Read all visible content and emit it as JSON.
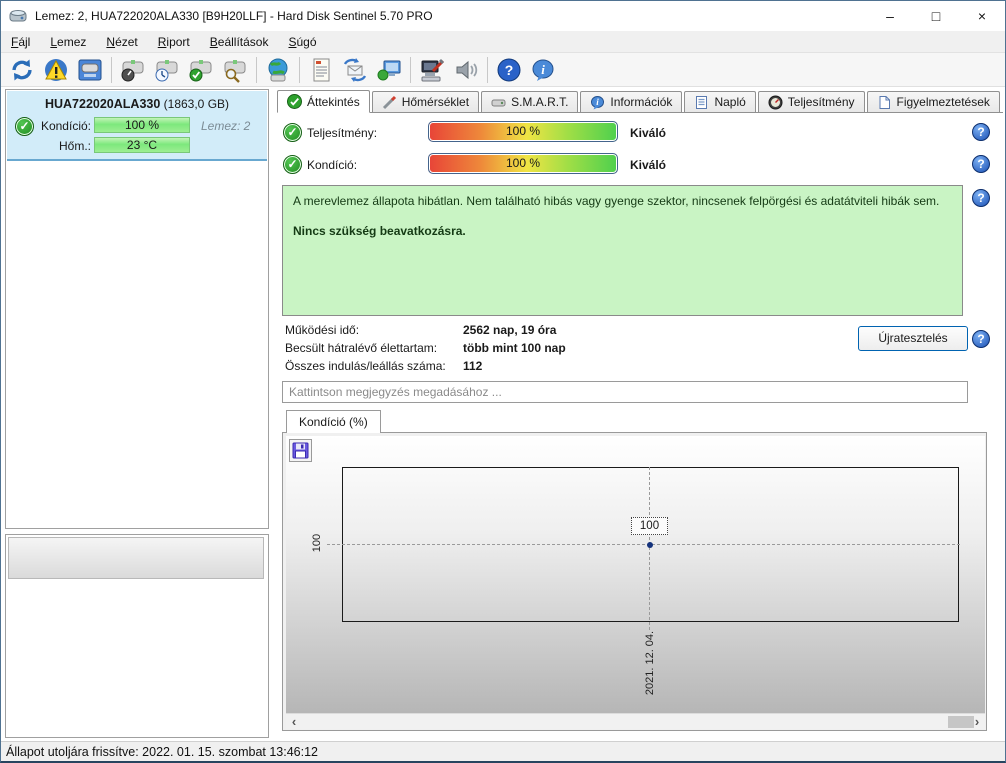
{
  "window": {
    "title": "Lemez: 2, HUA722020ALA330 [B9H20LLF]  -  Hard Disk Sentinel 5.70 PRO",
    "minimize": "–",
    "maximize": "□",
    "close": "×"
  },
  "menu": {
    "items": [
      {
        "accel": "F",
        "rest": "ájl"
      },
      {
        "accel": "L",
        "rest": "emez"
      },
      {
        "accel": "N",
        "rest": "ézet"
      },
      {
        "accel": "R",
        "rest": "iport"
      },
      {
        "accel": "B",
        "rest": "eállítások"
      },
      {
        "accel": "S",
        "rest": "úgó"
      }
    ]
  },
  "toolbar": {
    "icons": [
      "refresh-icon",
      "disk-warning-icon",
      "disk-monitor-icon",
      "disk-performance-icon",
      "disk-clock-icon",
      "disk-ok-icon",
      "disk-search-icon",
      "network-disks-icon",
      "report-icon",
      "send-report-icon",
      "remote-monitor-icon",
      "hardware-test-icon",
      "sound-icon",
      "help-icon",
      "info-icon"
    ]
  },
  "sidebar": {
    "disk": {
      "model": "HUA722020ALA330",
      "size": "(1863,0 GB)",
      "condition_label": "Kondíció:",
      "condition_value": "100 %",
      "temperature_label": "Hőm.:",
      "temperature_value": "23 °C",
      "disk_tag": "Lemez: 2"
    }
  },
  "tabs": [
    {
      "label": "Áttekintés"
    },
    {
      "label": "Hőmérséklet"
    },
    {
      "label": "S.M.A.R.T."
    },
    {
      "label": "Információk"
    },
    {
      "label": "Napló"
    },
    {
      "label": "Teljesítmény"
    },
    {
      "label": "Figyelmeztetések"
    }
  ],
  "overview": {
    "performance_label": "Teljesítmény:",
    "performance_value": "100 %",
    "performance_rating": "Kiváló",
    "condition_label": "Kondíció:",
    "condition_value": "100 %",
    "condition_rating": "Kiváló",
    "status_text": "A merevlemez állapota hibátlan. Nem található hibás vagy gyenge szektor, nincsenek felpörgési és adatátviteli hibák sem.",
    "status_advice": "Nincs szükség beavatkozásra.",
    "info_rows": [
      {
        "label": "Működési idő:",
        "value": "2562 nap, 19 óra"
      },
      {
        "label": "Becsült hátralévő élettartam:",
        "value": "több mint 100 nap"
      },
      {
        "label": "Összes indulás/leállás száma:",
        "value": "112"
      }
    ],
    "retest_button": "Újratesztelés",
    "comment_placeholder": "Kattintson megjegyzés megadásához ...",
    "help_icon": "?"
  },
  "chart_data": {
    "type": "line",
    "title": "Kondíció  (%)",
    "x": [
      "2021. 12. 04."
    ],
    "series": [
      {
        "name": "Kondíció",
        "values": [
          100
        ]
      }
    ],
    "y_tick_label": "100",
    "x_tick_label": "2021. 12. 04.",
    "point_label": "100",
    "grid": "dashed-crosshair",
    "legend": "none"
  },
  "chart_scroll": {
    "left": "‹",
    "right": "›"
  },
  "statusbar": {
    "text": "Állapot utoljára frissítve: 2022. 01. 15. szombat 13:46:12"
  },
  "colors": {
    "health_green": "#1f8a1f",
    "bar_red": "#e84438",
    "bar_yellow": "#f0e444",
    "bar_green": "#4ed04e",
    "sidebar_card_bg": "#d2ecf9",
    "status_box_bg": "#c9f4c4",
    "help_blue": "#1a50b4",
    "retest_border_blue": "#0063b1"
  }
}
